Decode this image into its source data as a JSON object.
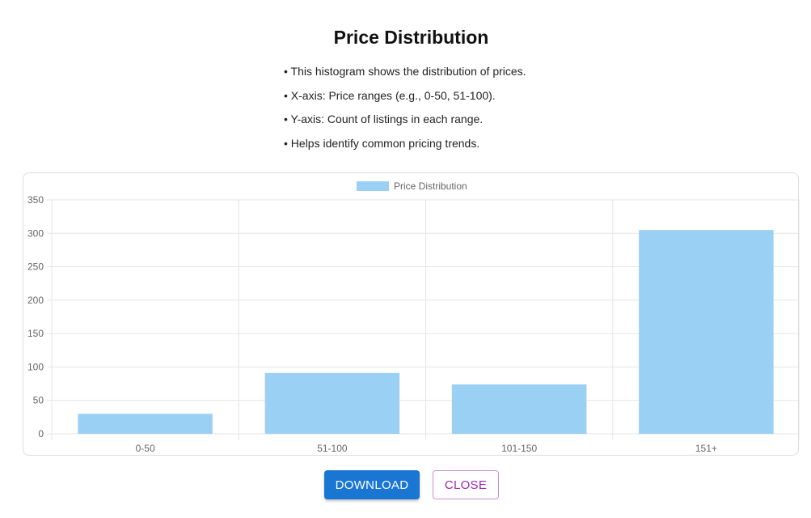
{
  "dialog": {
    "title": "Price Distribution",
    "bullets": [
      "• This histogram shows the distribution of prices.",
      "• X-axis: Price ranges (e.g., 0-50, 51-100).",
      "• Y-axis: Count of listings in each range.",
      "• Helps identify common pricing trends."
    ],
    "download_label": "DOWNLOAD",
    "close_label": "CLOSE"
  },
  "colors": {
    "bar_fill": "#9bd0f5",
    "primary": "#1976d2",
    "secondary": "#9c27b0",
    "grid": "#e5e5e5"
  },
  "chart_data": {
    "type": "bar",
    "title": "",
    "xlabel": "",
    "ylabel": "",
    "categories": [
      "0-50",
      "51-100",
      "101-150",
      "151+"
    ],
    "series": [
      {
        "name": "Price Distribution",
        "values": [
          30,
          91,
          74,
          305
        ]
      }
    ],
    "ylim": [
      0,
      350
    ],
    "yticks": [
      "0",
      "50",
      "100",
      "150",
      "200",
      "250",
      "300",
      "350"
    ],
    "grid": true,
    "legend_position": "top-center"
  }
}
